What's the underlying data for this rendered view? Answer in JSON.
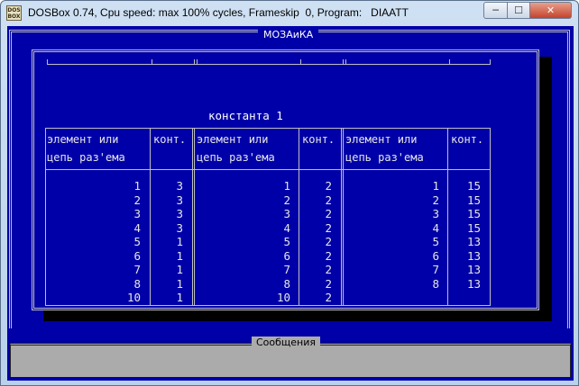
{
  "window": {
    "title": "DOSBox 0.74, Cpu speed: max 100% cycles, Frameskip  0, Program:   DIAATT",
    "icon_text": "DOS BOX",
    "min_symbol": "─",
    "max_symbol": "☐",
    "close_symbol": "✕"
  },
  "app": {
    "frame_title": "МОЗАиКА",
    "constant_title": "константа 1",
    "headers": [
      {
        "element": "элемент или\nцепь раз'ема",
        "contact": "конт."
      },
      {
        "element": "элемент или\nцепь раз'ема",
        "contact": "конт."
      },
      {
        "element": "элемент или\nцепь раз'ема",
        "contact": "конт."
      }
    ],
    "groups": [
      {
        "elements": [
          "1",
          "2",
          "3",
          "4",
          "5",
          "6",
          "7",
          "8",
          "10"
        ],
        "contacts": [
          "3",
          "3",
          "3",
          "3",
          "1",
          "1",
          "1",
          "1",
          "1"
        ]
      },
      {
        "elements": [
          "1",
          "2",
          "3",
          "4",
          "5",
          "6",
          "7",
          "8",
          "10"
        ],
        "contacts": [
          "2",
          "2",
          "2",
          "2",
          "2",
          "2",
          "2",
          "2",
          "2"
        ]
      },
      {
        "elements": [
          "1",
          "2",
          "3",
          "4",
          "5",
          "6",
          "7",
          "8"
        ],
        "contacts": [
          "15",
          "15",
          "15",
          "15",
          "13",
          "13",
          "13",
          "13"
        ]
      }
    ]
  },
  "messages": {
    "title": "Сообщения"
  }
}
